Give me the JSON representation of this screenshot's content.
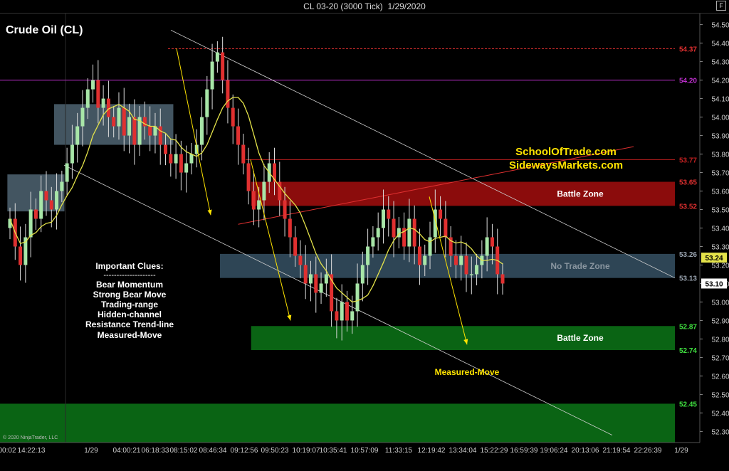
{
  "window": {
    "title": "CL 03-20 (3000 Tick)",
    "date": "1/29/2020",
    "f_button": "F",
    "panel_icon": "⊳|"
  },
  "chart_data": {
    "type": "candlestick",
    "title": "Crude Oil (CL)",
    "copyright": "© 2020 NinjaTrader, LLC",
    "ylim": [
      52.24,
      54.56
    ],
    "y_ticks": [
      52.3,
      52.4,
      52.5,
      52.6,
      52.7,
      52.8,
      52.9,
      53.0,
      53.1,
      53.2,
      53.3,
      53.4,
      53.5,
      53.6,
      53.7,
      53.8,
      53.9,
      54.0,
      54.1,
      54.2,
      54.3,
      54.4,
      54.5
    ],
    "x_ticks": [
      "00:02",
      "14:22:13",
      "1/29",
      "04:00:21",
      "06:18:33",
      "08:15:02",
      "08:46:34",
      "09:12:56",
      "09:50:23",
      "10:19:07",
      "10:35:41",
      "10:57:09",
      "11:33:15",
      "12:19:42",
      "13:34:04",
      "15:22:29",
      "16:59:39",
      "19:06:24",
      "20:13:06",
      "21:19:54",
      "22:26:39",
      "1/29"
    ],
    "last_price": 53.1,
    "ma_value": 53.24,
    "ma_color": "#e4e34a",
    "up_color": "#a8e6a8",
    "down_color": "#e03030",
    "closes": [
      53.45,
      53.3,
      53.2,
      53.35,
      53.5,
      53.45,
      53.6,
      53.55,
      53.5,
      53.6,
      53.65,
      53.75,
      53.85,
      53.95,
      54.05,
      54.15,
      54.2,
      54.05,
      54.1,
      54.0,
      53.95,
      54.05,
      53.9,
      54.0,
      53.85,
      54.0,
      53.95,
      53.9,
      53.95,
      53.85,
      53.8,
      53.75,
      53.8,
      53.7,
      53.75,
      53.8,
      53.85,
      54.0,
      54.15,
      54.3,
      54.35,
      54.2,
      54.05,
      53.95,
      53.85,
      53.75,
      53.6,
      53.5,
      53.55,
      53.65,
      53.75,
      53.65,
      53.55,
      53.45,
      53.35,
      53.25,
      53.2,
      53.1,
      53.15,
      53.05,
      53.1,
      53.15,
      52.95,
      52.9,
      53.0,
      52.9,
      52.95,
      53.1,
      53.2,
      53.3,
      53.35,
      53.4,
      53.5,
      53.45,
      53.35,
      53.4,
      53.3,
      53.45,
      53.3,
      53.2,
      53.25,
      53.35,
      53.5,
      53.45,
      53.35,
      53.25,
      53.2,
      53.25,
      53.15,
      53.15,
      53.2,
      53.25,
      53.35,
      53.3,
      53.15,
      53.1
    ],
    "levels": [
      {
        "label": "54.37",
        "value": 54.37,
        "color": "#e03030",
        "style": "dash"
      },
      {
        "label": "54.20",
        "value": 54.2,
        "color": "#c030d0",
        "style": "solid"
      },
      {
        "label": "53.77",
        "value": 53.77,
        "color": "#c02020",
        "style": "solid"
      },
      {
        "label": "53.65",
        "value": 53.65,
        "color": "#e03030",
        "style": "none"
      },
      {
        "label": "53.52",
        "value": 53.52,
        "color": "#e03030",
        "style": "none"
      },
      {
        "label": "53.26",
        "value": 53.26,
        "color": "#9aa4b0",
        "style": "none"
      },
      {
        "label": "53.13",
        "value": 53.13,
        "color": "#9aa4b0",
        "style": "none"
      },
      {
        "label": "52.87",
        "value": 52.87,
        "color": "#40e040",
        "style": "none"
      },
      {
        "label": "52.74",
        "value": 52.74,
        "color": "#40e040",
        "style": "none"
      },
      {
        "label": "52.45",
        "value": 52.45,
        "color": "#40e040",
        "style": "none"
      }
    ],
    "zones": [
      {
        "label": "Battle Zone",
        "y1": 53.52,
        "y2": 53.65,
        "color": "#8b0c0c",
        "text_color": "#ffffff",
        "bar_start": 47
      },
      {
        "label": "No Trade Zone",
        "y1": 53.13,
        "y2": 53.26,
        "color": "#2e4555",
        "text_color": "#8a96a0",
        "bar_start": 41
      },
      {
        "label": "Battle Zone",
        "y1": 52.74,
        "y2": 52.87,
        "color": "#0a6414",
        "text_color": "#ffffff",
        "bar_start": 47
      },
      {
        "label": "",
        "y1": 52.18,
        "y2": 52.45,
        "color": "#0a6414",
        "text_color": "#ffffff",
        "bar_start": 0
      }
    ],
    "ranges": [
      {
        "bar_start": 0,
        "bar_end": 10,
        "y1": 53.49,
        "y2": 53.69,
        "color": "#5a7282"
      },
      {
        "bar_start": 9,
        "bar_end": 31,
        "y1": 53.85,
        "y2": 54.07,
        "color": "#5a7282"
      }
    ],
    "watermark": [
      "SchoolOfTrade.com",
      "SidewaysMarkets.com"
    ],
    "watermark_color": "#ffe400",
    "clues_title": "Important Clues:",
    "clues_rule": "--------------------",
    "clues": [
      "Bear Momentum",
      "Strong Bear Move",
      "Trading-range",
      "Hidden-channel",
      "Resistance Trend-line",
      "Measured-Move"
    ],
    "measured_move_label": "Measured-Move",
    "annotation_color": "#ffe400"
  }
}
